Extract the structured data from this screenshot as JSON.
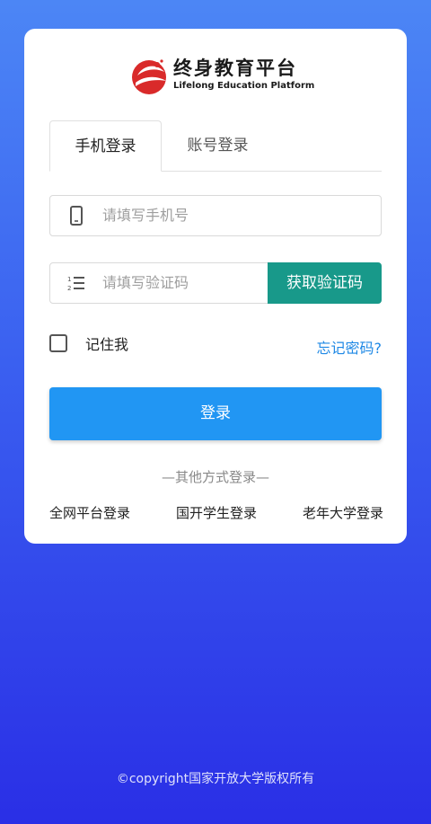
{
  "brand": {
    "name_cn": "终身教育平台",
    "name_en": "Lifelong Education Platform",
    "colors": {
      "red": "#d92a2a",
      "teal": "#18998a",
      "blue": "#2196f3"
    }
  },
  "tabs": [
    {
      "label": "手机登录",
      "active": true
    },
    {
      "label": "账号登录",
      "active": false
    }
  ],
  "phone_field": {
    "icon": "phone-icon",
    "placeholder": "请填写手机号",
    "value": ""
  },
  "code_field": {
    "icon": "list-number-icon",
    "placeholder": "请填写验证码",
    "value": "",
    "button_label": "获取验证码"
  },
  "remember": {
    "label": "记住我",
    "checked": false
  },
  "forgot_label": "忘记密码?",
  "login_label": "登录",
  "other_login": {
    "title": "—其他方式登录—",
    "options": [
      "全网平台登录",
      "国开学生登录",
      "老年大学登录"
    ]
  },
  "footer": {
    "copyright": "©copyright国家开放大学版权所有"
  }
}
